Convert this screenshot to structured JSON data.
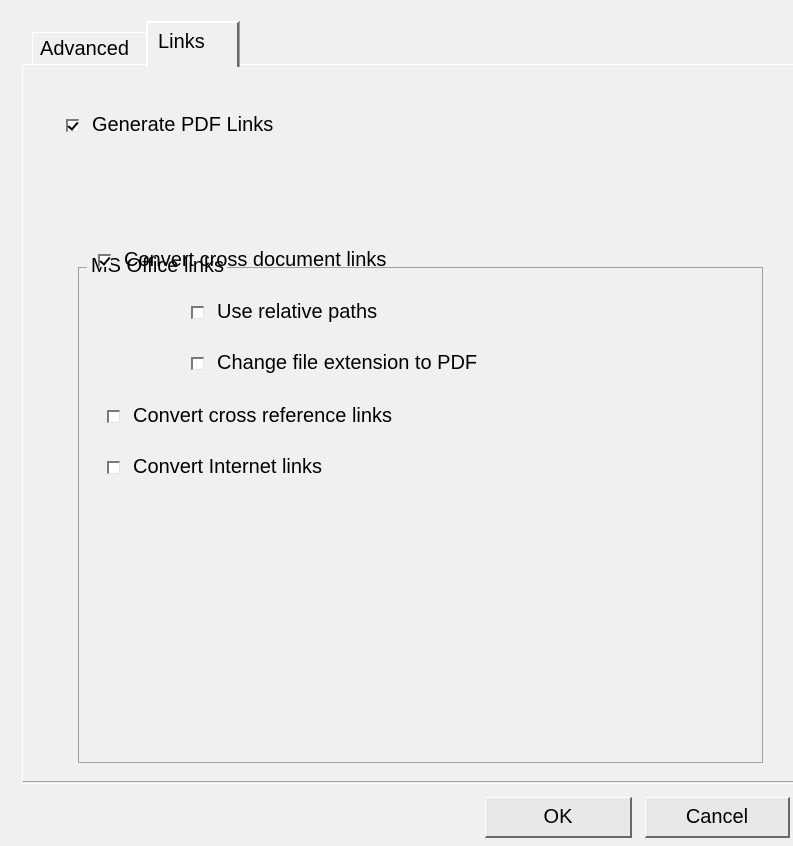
{
  "tabs": [
    {
      "label": "Advanced",
      "active": false
    },
    {
      "label": "Links",
      "active": true
    }
  ],
  "generate_pdf_links": {
    "label": "Generate PDF Links",
    "checked": true
  },
  "ms_office_group": {
    "title": "MS Office links",
    "items": [
      {
        "label": "Convert cross document links",
        "checked": true
      },
      {
        "label": "Use relative paths",
        "checked": false
      },
      {
        "label": "Change file extension to PDF",
        "checked": false
      },
      {
        "label": "Convert cross reference links",
        "checked": false
      },
      {
        "label": "Convert Internet links",
        "checked": false
      }
    ]
  },
  "buttons": {
    "ok_label": "OK",
    "cancel_label": "Cancel"
  }
}
